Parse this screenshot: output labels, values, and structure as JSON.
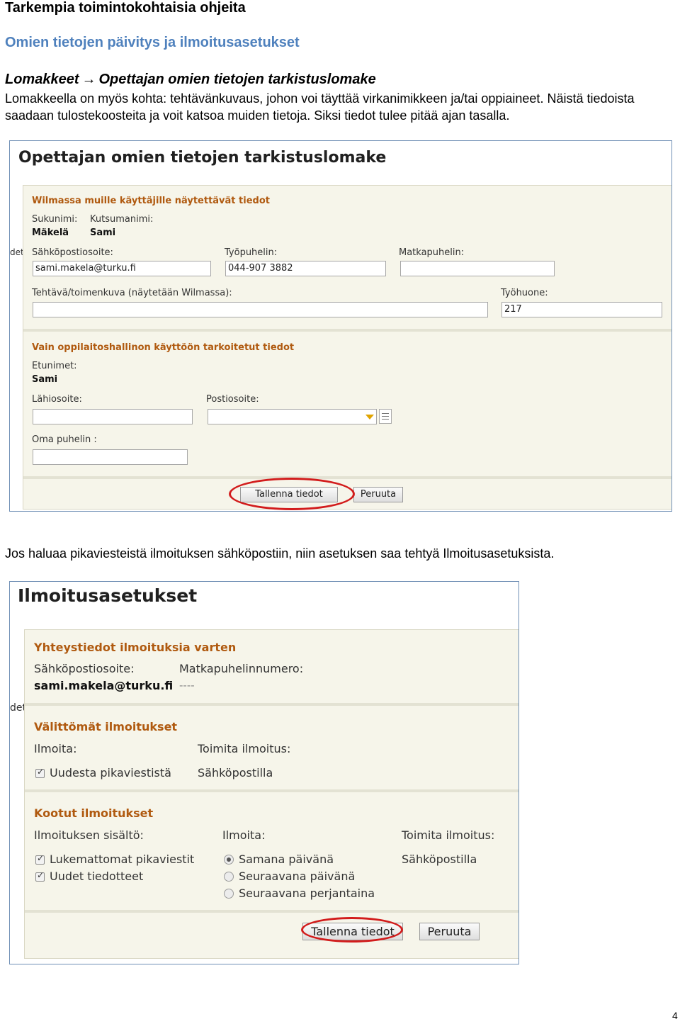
{
  "doc": {
    "heading": "Tarkempia toimintokohtaisia ohjeita",
    "subheading": "Omien tietojen päivitys ja ilmoitusasetukset",
    "path_from": "Lomakkeet",
    "path_arrow": "→",
    "path_to": "Opettajan omien tietojen tarkistuslomake",
    "paragraph1": "Lomakkeella on myös kohta: tehtävänkuvaus, johon voi täyttää virkanimikkeen ja/tai oppiaineet. Näistä tiedoista saadaan tulostekoosteita ja voit katsoa muiden tietoja. Siksi tiedot tulee pitää ajan tasalla.",
    "paragraph2": "Jos haluaa pikaviesteistä ilmoituksen sähköpostiin, niin asetuksen saa tehtyä Ilmoitusasetuksista.",
    "page_number": "4"
  },
  "form1": {
    "title": "Opettajan omien tietojen tarkistuslomake",
    "side_fragment": "det",
    "section_public": {
      "title": "Wilmassa muille käyttäjille näytettävät tiedot",
      "surname_label": "Sukunimi:",
      "surname_value": "Mäkelä",
      "nickname_label": "Kutsumanimi:",
      "nickname_value": "Sami",
      "email_label": "Sähköpostiosoite:",
      "email_value": "sami.makela@turku.fi",
      "workphone_label": "Työpuhelin:",
      "workphone_value": "044-907 3882",
      "mobile_label": "Matkapuhelin:",
      "mobile_value": "",
      "role_label": "Tehtävä/toimenkuva (näytetään Wilmassa):",
      "role_value": "",
      "room_label": "Työhuone:",
      "room_value": "217"
    },
    "section_private": {
      "title": "Vain oppilaitoshallinon käyttöön tarkoitetut tiedot",
      "firstnames_label": "Etunimet:",
      "firstnames_value": "Sami",
      "street_label": "Lähiosoite:",
      "street_value": "",
      "postal_label": "Postiosoite:",
      "postal_value": "",
      "phone_label": "Oma puhelin :",
      "phone_value": ""
    },
    "save_button": "Tallenna tiedot",
    "cancel_button": "Peruuta"
  },
  "form2": {
    "title": "Ilmoitusasetukset",
    "side_fragment": "det",
    "contact": {
      "title": "Yhteystiedot ilmoituksia varten",
      "email_label": "Sähköpostiosoite:",
      "email_value": "sami.makela@turku.fi",
      "mobile_label": "Matkapuhelinnumero:",
      "mobile_value": "----"
    },
    "immediate": {
      "title": "Välittömät ilmoitukset",
      "notify_label": "Ilmoita:",
      "deliver_label": "Toimita ilmoitus:",
      "option": "Uudesta pikaviestistä",
      "option_checked": true,
      "delivery": "Sähköpostilla"
    },
    "digest": {
      "title": "Kootut ilmoitukset",
      "content_label": "Ilmoituksen sisältö:",
      "notify_label": "Ilmoita:",
      "deliver_label": "Toimita ilmoitus:",
      "content_options": [
        {
          "label": "Lukemattomat pikaviestit",
          "checked": true
        },
        {
          "label": "Uudet tiedotteet",
          "checked": true
        }
      ],
      "timing_options": [
        {
          "label": "Samana päivänä",
          "selected": true
        },
        {
          "label": "Seuraavana päivänä",
          "selected": false
        },
        {
          "label": "Seuraavana perjantaina",
          "selected": false
        }
      ],
      "delivery": "Sähköpostilla"
    },
    "save_button": "Tallenna tiedot",
    "cancel_button": "Peruuta"
  },
  "colors": {
    "subheading": "#4f81bd",
    "section_title": "#b05a10",
    "panel_bg": "#f6f5ea",
    "highlight_ring": "#d21c1c"
  }
}
